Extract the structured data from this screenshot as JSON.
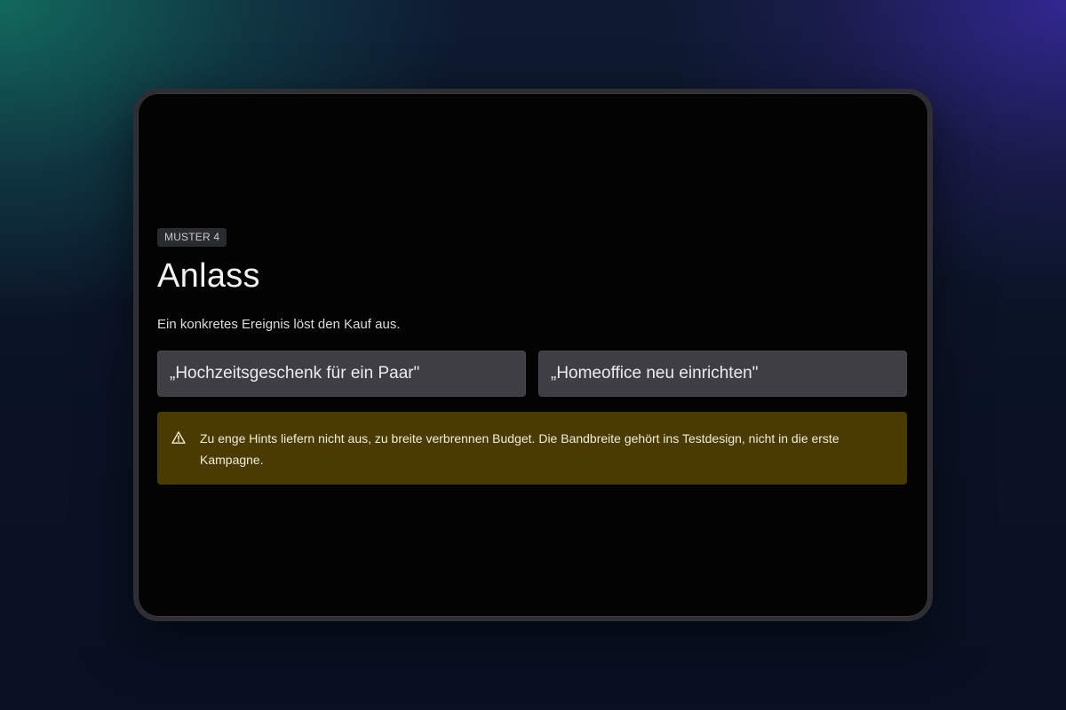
{
  "card": {
    "badge": "MUSTER 4",
    "title": "Anlass",
    "description": "Ein konkretes Ereignis löst den Kauf aus.",
    "examples": [
      "„Hochzeitsgeschenk für ein Paar\"",
      "„Homeoffice neu einrichten\""
    ],
    "warning": {
      "icon": "warning-triangle-icon",
      "text": "Zu enge Hints liefern nicht aus, zu breite verbrennen Budget. Die Bandbreite gehört ins Testdesign, nicht in die erste Kampagne."
    }
  },
  "colors": {
    "screen_background": "#030303",
    "example_background": "#3f3e44",
    "warning_background": "#4a3b02",
    "badge_background": "#2a2b2e"
  }
}
